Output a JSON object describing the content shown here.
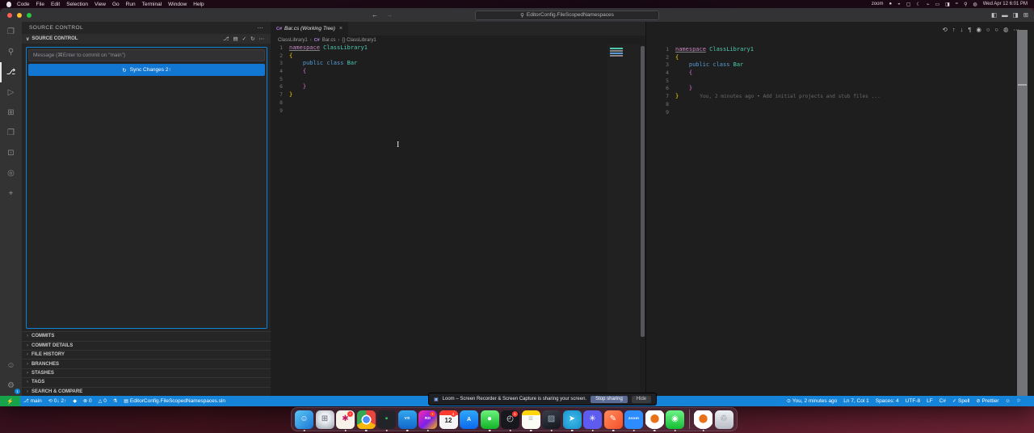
{
  "menubar": {
    "items": [
      "Code",
      "File",
      "Edit",
      "Selection",
      "View",
      "Go",
      "Run",
      "Terminal",
      "Window",
      "Help"
    ],
    "status_icons": [
      "zoom",
      "●",
      "◒",
      "▢",
      "☾",
      "⌁",
      "▭",
      "◨",
      "≈",
      "⚲",
      "◍"
    ],
    "clock": "Wed Apr 12 6:01 PM"
  },
  "titlebar": {
    "back": "←",
    "forward": "→",
    "search_icon": "⚲",
    "search_text": "EditorConfig.FileScopedNamespaces",
    "layout_icons": [
      "◧",
      "▬",
      "◨",
      "⊞"
    ]
  },
  "activity_bar": {
    "top": [
      {
        "name": "explorer-icon",
        "glyph": "❐"
      },
      {
        "name": "search-icon",
        "glyph": "⚲"
      },
      {
        "name": "source-control-icon",
        "glyph": "⎇",
        "cls": "active"
      },
      {
        "name": "run-debug-icon",
        "glyph": "▷"
      },
      {
        "name": "extensions-icon",
        "glyph": "⊞"
      },
      {
        "name": "remote-explorer-icon",
        "glyph": "❒"
      },
      {
        "name": "docker-icon",
        "glyph": "⊡"
      },
      {
        "name": "gitlens-icon",
        "glyph": "◎"
      },
      {
        "name": "gitlens-inspect-icon",
        "glyph": "⌖"
      }
    ],
    "bottom": [
      {
        "name": "accounts-icon",
        "glyph": "☺"
      },
      {
        "name": "settings-icon",
        "glyph": "⚙",
        "badge": "1"
      }
    ]
  },
  "scm": {
    "panel_title": "SOURCE CONTROL",
    "panel_more": "⋯",
    "chevron_open": "∨",
    "chevron": "›",
    "section_title": "SOURCE CONTROL",
    "section_icons": [
      "⎇",
      "▤",
      "✓",
      "↻",
      "⋯"
    ],
    "message_placeholder": "Message (⌘Enter to commit on \"main\")",
    "sync_icon": "↻",
    "sync_label": "Sync Changes 2↑",
    "sections": [
      {
        "label": "COMMITS"
      },
      {
        "label": "COMMIT DETAILS"
      },
      {
        "label": "FILE HISTORY"
      },
      {
        "label": "BRANCHES"
      },
      {
        "label": "STASHES"
      },
      {
        "label": "TAGS"
      },
      {
        "label": "SEARCH & COMPARE"
      }
    ]
  },
  "editor": {
    "tab": {
      "icon": "C#",
      "label": "Bar.cs (Working Tree)",
      "close": "×"
    },
    "breadcrumb": {
      "p1": "ClassLibrary1",
      "sep": "›",
      "file_icon": "C#",
      "p2": "Bar.cs",
      "p3": "{} ClassLibrary1"
    },
    "right_actions": [
      "⟲",
      "↑",
      "↓",
      "¶",
      "◉",
      "○",
      "○",
      "◍",
      "⋯"
    ],
    "code": {
      "language": "csharp",
      "lines": [
        {
          "n": "1",
          "a": "namespace",
          "ac": "kw u",
          "b": " ClassLibrary1",
          "bc": "type"
        },
        {
          "n": "2",
          "a": "{",
          "ac": "b1"
        },
        {
          "n": "3",
          "a": "    public class",
          "ac": "kw2",
          "b": " Bar",
          "bc": "type"
        },
        {
          "n": "4",
          "a": "    {",
          "ac": "b2"
        },
        {
          "n": "5"
        },
        {
          "n": "6",
          "a": "    }",
          "ac": "b2"
        },
        {
          "n": "7",
          "a": "}",
          "ac": "b1",
          "blame": "You, 2 minutes ago • Add initial projects and stub files ..."
        },
        {
          "n": "8"
        },
        {
          "n": "9"
        }
      ]
    }
  },
  "status_bar": {
    "remote_icon": "⚡",
    "left": [
      {
        "icon": "⎇",
        "label": "main"
      },
      {
        "icon": "⟲",
        "label": "0↓ 2↑"
      },
      {
        "icon": "◆",
        "label": ""
      },
      {
        "icon": "⊗",
        "label": "0"
      },
      {
        "icon": "△",
        "label": "0"
      },
      {
        "icon": "⚗",
        "label": ""
      },
      {
        "icon": "▤",
        "label": "EditorConfig.FileScopedNamespaces.sln"
      }
    ],
    "right": [
      {
        "icon": "⊙",
        "label": "You, 2 minutes ago"
      },
      {
        "label": "Ln 7, Col 1"
      },
      {
        "label": "Spaces: 4"
      },
      {
        "label": "UTF-8"
      },
      {
        "label": "LF"
      },
      {
        "label": "C#"
      },
      {
        "icon": "✓",
        "label": "Spell"
      },
      {
        "icon": "⊘",
        "label": "Prettier"
      },
      {
        "icon": "☺",
        "label": ""
      },
      {
        "icon": "⚐",
        "label": ""
      }
    ]
  },
  "share_bar": {
    "icon": "▣",
    "text": "Loom – Screen Recorder & Screen Capture is sharing your screen.",
    "stop_label": "Stop sharing",
    "hide_label": "Hide"
  },
  "dock": {
    "items": [
      {
        "name": "finder-icon",
        "bg": "linear-gradient(135deg,#59c6f5,#1c77d4)",
        "glyph": "☺",
        "fg": "#ffffff",
        "dot": "•"
      },
      {
        "name": "launchpad-icon",
        "bg": "radial-gradient(circle at 50% 40%,#eceff3 30%,#9aa3ad)",
        "glyph": "⊞",
        "fg": "#5f6670"
      },
      {
        "name": "slack-icon",
        "bg": "#f6f2ea",
        "glyph": "✱",
        "fg": "#c2185b",
        "badge": "•",
        "dot": "•"
      },
      {
        "name": "chrome-icon",
        "bg": "radial-gradient(circle at 50% 50%, #4e8df5 0 26%, #ffffff 27% 36%, rgba(0,0,0,0) 37%), conic-gradient(#e8453c 0deg 120deg, #f6b60b 120deg 240deg, #34a853 240deg 360deg)",
        "glyph": "",
        "fg": "#fff",
        "dot": "•"
      },
      {
        "name": "terminal-app-icon",
        "bg": "#23242a",
        "glyph": "▪",
        "fg": "#34c759",
        "dot": "•"
      },
      {
        "name": "vscode-icon",
        "bg": "linear-gradient(180deg,#31a8f0,#1266c9)",
        "glyph": "VS",
        "fg": "#ffffff",
        "cls": "tiny",
        "dot": "•"
      },
      {
        "name": "rider-icon",
        "bg": "linear-gradient(135deg,#ff2ba6,#7a1feb 55%,#ffb300)",
        "glyph": "RD",
        "fg": "#ffffff",
        "cls": "tiny",
        "badge": "•",
        "dot": "•"
      },
      {
        "name": "calendar-icon",
        "bg": "#f5f5f7",
        "glyph": "12",
        "fg": "#1c1c1e",
        "cls": "cal",
        "badge": "4",
        "dot": "•"
      },
      {
        "name": "app-store-icon",
        "bg": "linear-gradient(180deg,#2fa8f8,#0c68ee)",
        "glyph": "A",
        "fg": "#ffffff",
        "cls": "txt"
      },
      {
        "name": "messages-icon",
        "bg": "linear-gradient(180deg,#6bf27d,#12b327)",
        "glyph": "●",
        "fg": "#ffffff",
        "dot": "•"
      },
      {
        "name": "clock-app-icon",
        "bg": "#17181d",
        "glyph": "◴",
        "fg": "#e8e8ee",
        "badge": "1",
        "dot": "•"
      },
      {
        "name": "notes-icon",
        "bg": "linear-gradient(180deg,#ffd60a 0%,#ffd60a 26%,#fbfbf6 26%)",
        "glyph": "≡",
        "fg": "#b0b0ae",
        "dot": "•"
      },
      {
        "name": "media-app-icon",
        "bg": "linear-gradient(160deg,#3a3f4a,#14161c)",
        "glyph": "▨",
        "fg": "#9fb4c8",
        "dot": "•"
      },
      {
        "name": "telegram-icon",
        "bg": "radial-gradient(circle,#41b8e8,#1593cf)",
        "glyph": "➤",
        "fg": "#ffffff",
        "dot": "•"
      },
      {
        "name": "loom-icon",
        "bg": "#5d5bf0",
        "glyph": "✳",
        "fg": "#ffffff",
        "dot": "•"
      },
      {
        "name": "postman-icon",
        "bg": "linear-gradient(135deg,#ff8a5c,#f4502a)",
        "glyph": "✎",
        "fg": "#ffffff",
        "dot": "•"
      },
      {
        "name": "zoom-icon",
        "bg": "#2d8cff",
        "glyph": "zoom",
        "fg": "#ffffff",
        "cls": "tiny",
        "dot": "•"
      },
      {
        "name": "keyhole-app-icon",
        "bg": "radial-gradient(circle at 50% 45%, #e8711a 0 30%, #ffffff 31% 75%, rgba(255,255,255,0) 76%)",
        "glyph": "",
        "fg": "#7a3a00",
        "dot": "•"
      },
      {
        "name": "facetime-icon",
        "bg": "linear-gradient(180deg,#6df287,#15bd33)",
        "glyph": "◉",
        "fg": "#ffffff",
        "dot": "•"
      }
    ],
    "items2": [
      {
        "name": "openvpn-icon",
        "bg": "radial-gradient(circle at 50% 45%, #e8711a 0 30%, #ffffff 31% 75%, rgba(255,255,255,0) 76%)",
        "glyph": "",
        "fg": "#7a3a00",
        "dot": "•"
      },
      {
        "name": "trash-icon",
        "bg": "linear-gradient(180deg,#eceff3,#b9bdc6)",
        "glyph": "♲",
        "fg": "#6a6f78"
      }
    ]
  },
  "cursor_glyph": "I"
}
